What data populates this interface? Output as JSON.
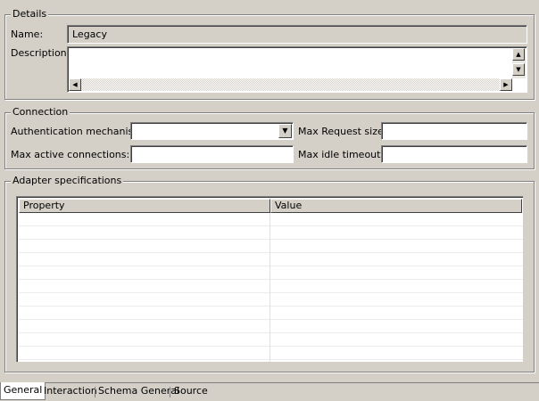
{
  "details": {
    "title": "Details",
    "name_label": "Name:",
    "name_value": "Legacy",
    "description_label": "Description:",
    "description_value": ""
  },
  "connection": {
    "title": "Connection",
    "auth_label": "Authentication mechanism:",
    "auth_value": "",
    "max_request_label": "Max Request size:",
    "max_request_value": "",
    "max_active_label": "Max active connections:",
    "max_active_value": "",
    "max_idle_label": "Max idle timeout:",
    "max_idle_value": ""
  },
  "adapter": {
    "title": "Adapter specifications",
    "columns": [
      "Property",
      "Value"
    ],
    "rows": []
  },
  "tabs": [
    {
      "label": "General",
      "active": true
    },
    {
      "label": "Interaction",
      "active": false
    },
    {
      "label": "Schema General",
      "active": false
    },
    {
      "label": "Source",
      "active": false
    }
  ],
  "icons": {
    "scroll_up": "arrow-up-icon",
    "scroll_down": "arrow-down-icon",
    "scroll_left": "arrow-left-icon",
    "scroll_right": "arrow-right-icon",
    "dropdown": "chevron-down-icon"
  }
}
